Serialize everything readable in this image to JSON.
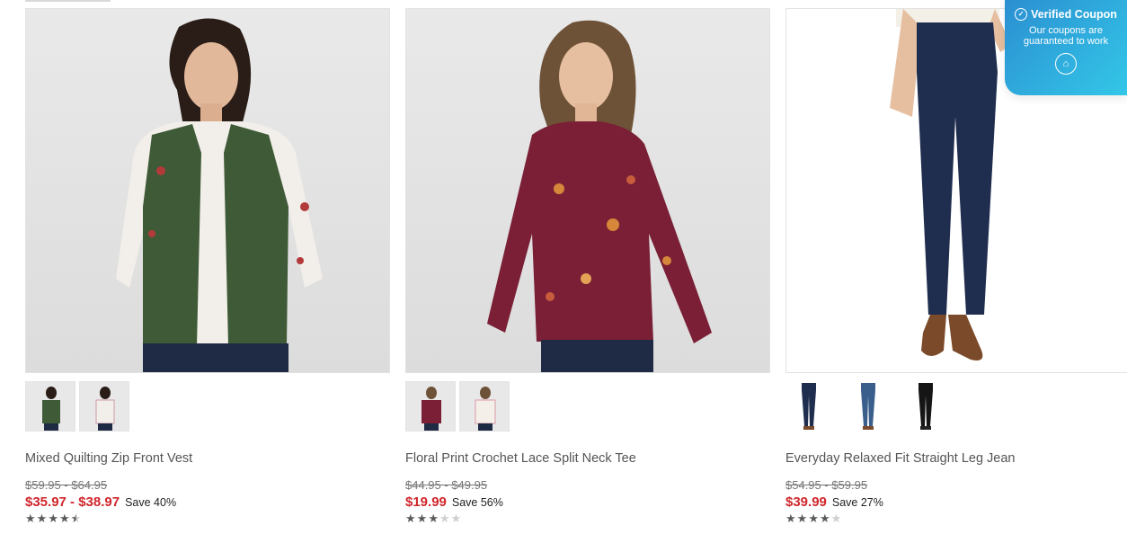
{
  "coupon": {
    "title": "Verified Coupon",
    "line1": "Our coupons are",
    "line2": "guaranteed to work",
    "icon": "home-icon"
  },
  "products": [
    {
      "name": "Mixed Quilting Zip Front Vest",
      "original_price": "$59.95 - $64.95",
      "sale_price": "$35.97 - $38.97",
      "savings": "Save 40%",
      "rating": 4.5,
      "thumbnail_count": 2,
      "colors": {
        "top": "#f2efea",
        "accent": "#3f5a36",
        "pants": "#1f2a44"
      }
    },
    {
      "name": "Floral Print Crochet Lace Split Neck Tee",
      "original_price": "$44.95 - $49.95",
      "sale_price": "$19.99",
      "savings": "Save 56%",
      "rating": 3,
      "thumbnail_count": 2,
      "colors": {
        "top": "#7a1f35",
        "accent": "#d6873a",
        "pants": "#1f2a44"
      }
    },
    {
      "name": "Everyday Relaxed Fit Straight Leg Jean",
      "original_price": "$54.95 - $59.95",
      "sale_price": "$39.99",
      "savings": "Save 27%",
      "rating": 4,
      "thumbnail_count": 3,
      "colors": {
        "top": "#f3f0e8",
        "accent": "#7b4a2a",
        "pants": "#1f2d4e"
      }
    }
  ],
  "colors": {
    "sale": "#d0262b",
    "coupon_start": "#2b8fd1",
    "coupon_end": "#33c7e8"
  }
}
